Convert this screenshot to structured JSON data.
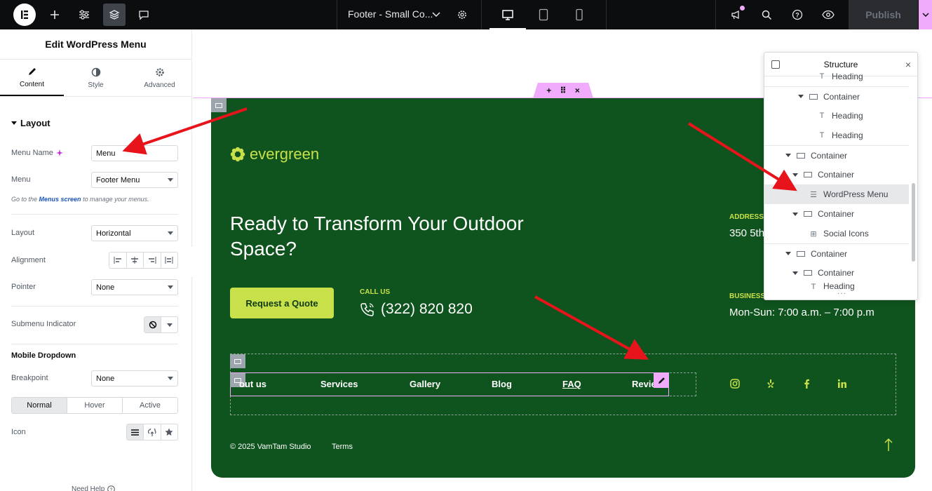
{
  "topbar": {
    "document_title": "Footer - Small Co...",
    "publish_label": "Publish",
    "icons": [
      "elementor-logo-icon",
      "add-icon",
      "settings-sliders-icon",
      "structure-layers-icon",
      "comments-icon",
      "gear-icon",
      "desktop-icon",
      "tablet-icon",
      "mobile-icon",
      "whats-new-icon",
      "search-icon",
      "help-icon",
      "preview-eye-icon",
      "chevron-down-icon"
    ]
  },
  "panel": {
    "title": "Edit WordPress Menu",
    "tabs": [
      {
        "label": "Content",
        "icon": "pencil-icon"
      },
      {
        "label": "Style",
        "icon": "half-circle-icon"
      },
      {
        "label": "Advanced",
        "icon": "gear-icon"
      }
    ],
    "layout_section": "Layout",
    "menu_name_label": "Menu Name",
    "menu_name_value": "Menu",
    "menu_label": "Menu",
    "menu_value": "Footer Menu",
    "hint_prefix": "Go to the ",
    "hint_link": "Menus screen",
    "hint_suffix": " to manage your menus.",
    "layout_label": "Layout",
    "layout_value": "Horizontal",
    "alignment_label": "Alignment",
    "pointer_label": "Pointer",
    "pointer_value": "None",
    "submenu_label": "Submenu Indicator",
    "mobile_section": "Mobile Dropdown",
    "breakpoint_label": "Breakpoint",
    "breakpoint_value": "None",
    "state_tabs": [
      "Normal",
      "Hover",
      "Active"
    ],
    "icon_label": "Icon",
    "need_help": "Need Help"
  },
  "footer": {
    "brand": "evergreen",
    "headline": "Ready to Transform Your Outdoor Space?",
    "quote_button": "Request a Quote",
    "call_label": "CALL US",
    "call_number": "(322) 820 820",
    "address_label": "ADDRESS",
    "address_value": "350 5th",
    "hours_label": "BUSINESS",
    "hours_value": "Mon-Sun: 7:00 a.m. – 7:00 p.m",
    "menu_items": [
      "out us",
      "Services",
      "Gallery",
      "Blog",
      "FAQ",
      "Revie"
    ],
    "social_icons": [
      "instagram-icon",
      "yelp-icon",
      "facebook-icon",
      "linkedin-icon"
    ],
    "copyright": "© 2025 VamTam Studio",
    "terms": "Terms"
  },
  "structure": {
    "title": "Structure",
    "items": [
      {
        "label": "Heading",
        "type": "heading",
        "expanded": null
      },
      {
        "label": "Container",
        "type": "container",
        "expanded": true
      },
      {
        "label": "Heading",
        "type": "heading",
        "expanded": null
      },
      {
        "label": "Heading",
        "type": "heading",
        "expanded": null
      },
      {
        "label": "Container",
        "type": "container",
        "expanded": true
      },
      {
        "label": "Container",
        "type": "container",
        "expanded": true
      },
      {
        "label": "WordPress Menu",
        "type": "menu",
        "expanded": null,
        "selected": true
      },
      {
        "label": "Container",
        "type": "container",
        "expanded": true
      },
      {
        "label": "Social Icons",
        "type": "social",
        "expanded": null
      },
      {
        "label": "Container",
        "type": "container",
        "expanded": true
      },
      {
        "label": "Container",
        "type": "container",
        "expanded": true
      },
      {
        "label": "Heading",
        "type": "heading",
        "expanded": null
      }
    ]
  },
  "colors": {
    "footer_bg": "#0f531e",
    "accent_lime": "#c8e04a",
    "editor_pink": "#f0abfc",
    "annotation_red": "#e8141b"
  }
}
